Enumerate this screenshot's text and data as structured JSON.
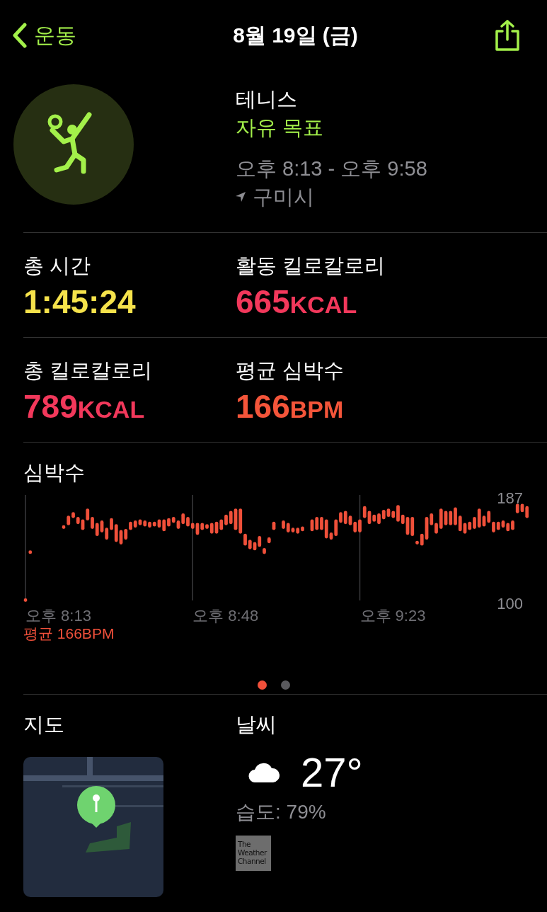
{
  "nav": {
    "back": "운동",
    "title": "8월 19일 (금)"
  },
  "workout": {
    "name": "테니스",
    "goal": "자유 목표",
    "time": "오후 8:13 - 오후 9:58",
    "location": "구미시"
  },
  "stats": [
    {
      "label": "총 시간",
      "value": "1:45:24",
      "color": "#f5e24b"
    },
    {
      "label": "활동 킬로칼로리",
      "value": "665",
      "unit": "KCAL",
      "color": "#f2385b"
    },
    {
      "label": "총 킬로칼로리",
      "value": "789",
      "unit": "KCAL",
      "color": "#f2385b"
    },
    {
      "label": "평균 심박수",
      "value": "166",
      "unit": "BPM",
      "color": "#f4553a"
    }
  ],
  "heart_rate": {
    "title": "심박수",
    "max_label": "187",
    "min_label": "100",
    "time_labels": [
      "오후 8:13",
      "오후 8:48",
      "오후 9:23"
    ],
    "average": "평균 166BPM"
  },
  "pages": [
    {
      "selected": true
    },
    {
      "selected": false
    }
  ],
  "map": {
    "title": "지도"
  },
  "weather": {
    "title": "날씨",
    "temperature": "27°",
    "humidity": "습도: 79%",
    "provider": "The Weather Channel"
  }
}
